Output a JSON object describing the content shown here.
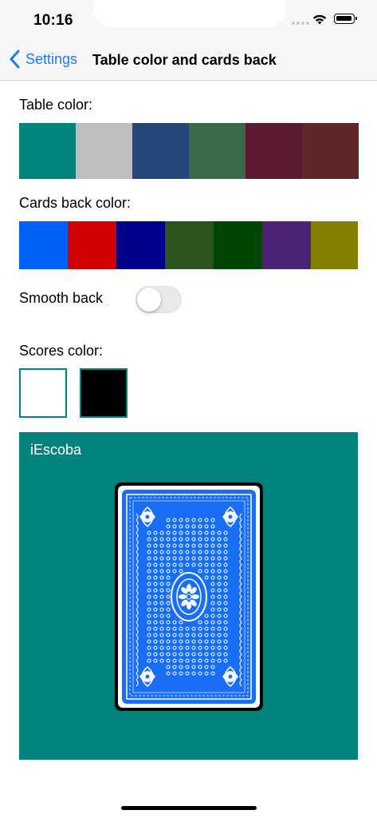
{
  "status_bar": {
    "time": "10:16",
    "signal_icon": "cellular-signal-icon",
    "wifi_icon": "wifi-icon",
    "battery_icon": "battery-icon"
  },
  "nav": {
    "back_label": "Settings",
    "back_icon": "chevron-left-icon",
    "title": "Table color and cards back",
    "accent_color": "#1a7afc"
  },
  "table_color": {
    "label": "Table color:",
    "swatches": [
      "#00827d",
      "#bfbfbf",
      "#24467a",
      "#386a48",
      "#5b1a30",
      "#5e2624"
    ]
  },
  "cards_back_color": {
    "label": "Cards back color:",
    "swatches": [
      "#0061f7",
      "#d30000",
      "#00008a",
      "#2d541d",
      "#004401",
      "#4c2373",
      "#857f00"
    ]
  },
  "smooth_back": {
    "label": "Smooth back",
    "enabled": false
  },
  "scores_color": {
    "label": "Scores color:",
    "swatches": [
      "#ffffff",
      "#000000"
    ],
    "border_color": "#00827d"
  },
  "preview": {
    "title": "iEscoba",
    "table_color": "#00827d",
    "card_back_color": "#1a6ef5"
  }
}
